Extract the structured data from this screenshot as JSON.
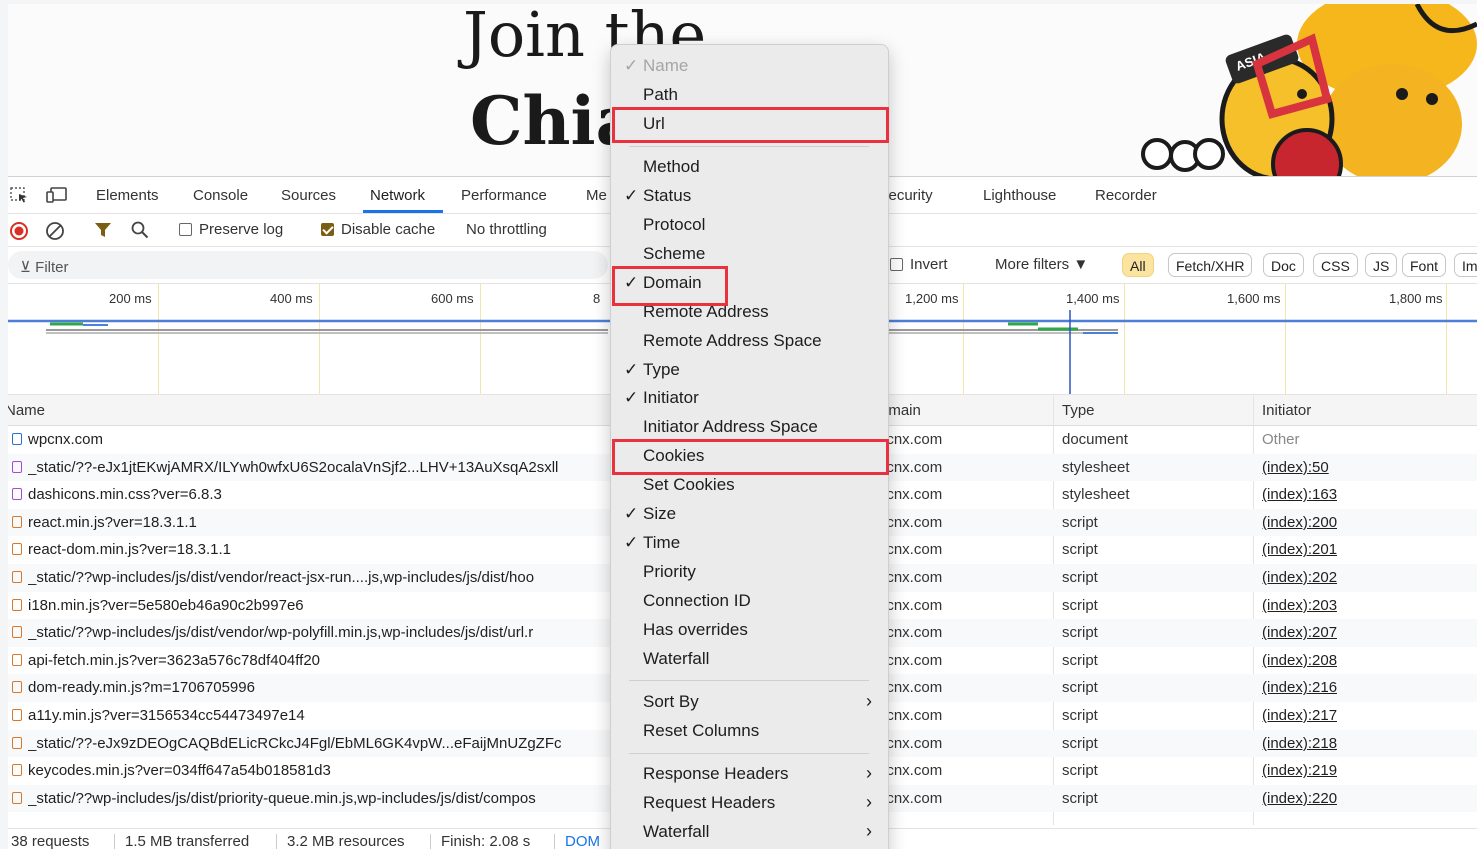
{
  "webpage": {
    "hero_line1": "Join the",
    "hero_line2": "Chia",
    "mascot_badge": "ASIA"
  },
  "devtools": {
    "tabs": [
      "Elements",
      "Console",
      "Sources",
      "Network",
      "Performance",
      "Me",
      "security",
      "Lighthouse",
      "Recorder"
    ],
    "active_tab": "Network",
    "toolbar": {
      "preserve_log": "Preserve log",
      "disable_cache": "Disable cache",
      "throttling": "No throttling"
    },
    "filter": {
      "placeholder": "Filter",
      "invert": "Invert",
      "more_filters": "More filters ▼",
      "chips": [
        "All",
        "Fetch/XHR",
        "Doc",
        "CSS",
        "JS",
        "Font",
        "Im"
      ]
    },
    "timeline_ticks": [
      "200 ms",
      "400 ms",
      "600 ms",
      "8",
      "1,200 ms",
      "1,400 ms",
      "1,600 ms",
      "1,800 ms"
    ],
    "columns": {
      "name": "Name",
      "domain": "omain",
      "type": "Type",
      "initiator": "Initiator"
    },
    "rows": [
      {
        "icon": "doc",
        "name": "wpcnx.com",
        "domain": "pcnx.com",
        "type": "document",
        "initiator": "Other"
      },
      {
        "icon": "css",
        "name": "_static/??-eJx1jtEKwjAMRX/ILYwh0wfxU6S2ocalaVnSjf2...LHV+13AuXsqA2sxll",
        "domain": "pcnx.com",
        "type": "stylesheet",
        "initiator": "(index):50"
      },
      {
        "icon": "css",
        "name": "dashicons.min.css?ver=6.8.3",
        "domain": "pcnx.com",
        "type": "stylesheet",
        "initiator": "(index):163"
      },
      {
        "icon": "js",
        "name": "react.min.js?ver=18.3.1.1",
        "domain": "pcnx.com",
        "type": "script",
        "initiator": "(index):200"
      },
      {
        "icon": "js",
        "name": "react-dom.min.js?ver=18.3.1.1",
        "domain": "pcnx.com",
        "type": "script",
        "initiator": "(index):201"
      },
      {
        "icon": "js",
        "name": "_static/??wp-includes/js/dist/vendor/react-jsx-run....js,wp-includes/js/dist/hoo",
        "domain": "pcnx.com",
        "type": "script",
        "initiator": "(index):202"
      },
      {
        "icon": "js",
        "name": "i18n.min.js?ver=5e580eb46a90c2b997e6",
        "domain": "pcnx.com",
        "type": "script",
        "initiator": "(index):203"
      },
      {
        "icon": "js",
        "name": "_static/??wp-includes/js/dist/vendor/wp-polyfill.min.js,wp-includes/js/dist/url.r",
        "domain": "pcnx.com",
        "type": "script",
        "initiator": "(index):207"
      },
      {
        "icon": "js",
        "name": "api-fetch.min.js?ver=3623a576c78df404ff20",
        "domain": "pcnx.com",
        "type": "script",
        "initiator": "(index):208"
      },
      {
        "icon": "js",
        "name": "dom-ready.min.js?m=1706705996",
        "domain": "pcnx.com",
        "type": "script",
        "initiator": "(index):216"
      },
      {
        "icon": "js",
        "name": "a11y.min.js?ver=3156534cc54473497e14",
        "domain": "pcnx.com",
        "type": "script",
        "initiator": "(index):217"
      },
      {
        "icon": "js",
        "name": "_static/??-eJx9zDEOgCAQBdELicRCkcJ4Fgl/EbML6GK4vpW...eFaijMnUZgZFc",
        "domain": "pcnx.com",
        "type": "script",
        "initiator": "(index):218"
      },
      {
        "icon": "js",
        "name": "keycodes.min.js?ver=034ff647a54b018581d3",
        "domain": "pcnx.com",
        "type": "script",
        "initiator": "(index):219"
      },
      {
        "icon": "js",
        "name": "_static/??wp-includes/js/dist/priority-queue.min.js,wp-includes/js/dist/compos",
        "domain": "pcnx.com",
        "type": "script",
        "initiator": "(index):220"
      }
    ],
    "status": {
      "requests": "38 requests",
      "transferred": "1.5 MB transferred",
      "resources": "3.2 MB resources",
      "finish": "Finish: 2.08 s",
      "dom": "DOM"
    }
  },
  "context_menu": {
    "items": [
      {
        "label": "Name",
        "checked": true,
        "disabled": true
      },
      {
        "label": "Path",
        "checked": false
      },
      {
        "label": "Url",
        "checked": false,
        "highlighted": true
      },
      {
        "separator": true
      },
      {
        "label": "Method",
        "checked": false
      },
      {
        "label": "Status",
        "checked": true
      },
      {
        "label": "Protocol",
        "checked": false
      },
      {
        "label": "Scheme",
        "checked": false
      },
      {
        "label": "Domain",
        "checked": true,
        "highlighted": true
      },
      {
        "label": "Remote Address",
        "checked": false
      },
      {
        "label": "Remote Address Space",
        "checked": false
      },
      {
        "label": "Type",
        "checked": true
      },
      {
        "label": "Initiator",
        "checked": true
      },
      {
        "label": "Initiator Address Space",
        "checked": false
      },
      {
        "label": "Cookies",
        "checked": false,
        "highlighted": true
      },
      {
        "label": "Set Cookies",
        "checked": false
      },
      {
        "label": "Size",
        "checked": true
      },
      {
        "label": "Time",
        "checked": true
      },
      {
        "label": "Priority",
        "checked": false
      },
      {
        "label": "Connection ID",
        "checked": false
      },
      {
        "label": "Has overrides",
        "checked": false
      },
      {
        "label": "Waterfall",
        "checked": false
      },
      {
        "separator": true
      },
      {
        "label": "Sort By",
        "submenu": true
      },
      {
        "label": "Reset Columns"
      },
      {
        "separator": true
      },
      {
        "label": "Response Headers",
        "submenu": true
      },
      {
        "label": "Request Headers",
        "submenu": true
      },
      {
        "label": "Waterfall",
        "submenu": true
      }
    ],
    "check_glyph": "✓",
    "arrow_glyph": "›"
  },
  "colors": {
    "accent": "#1a73e8",
    "highlight_box": "#e8333f",
    "active_chip": "#fbe3a0",
    "record_stop": "#d93025"
  }
}
